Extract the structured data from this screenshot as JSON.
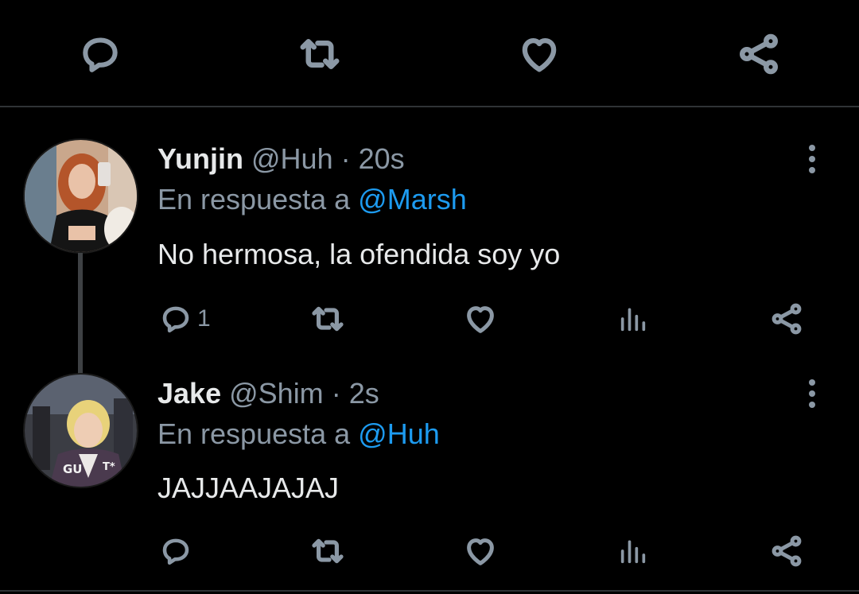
{
  "top_actions": {
    "icons": [
      "reply-icon",
      "retweet-icon",
      "like-icon",
      "share-icon"
    ]
  },
  "tweets": [
    {
      "name": "Yunjin",
      "handle": "@Huh",
      "separator": "·",
      "time": "20s",
      "reply_prefix": "En respuesta a",
      "reply_to": "@Marsh",
      "text": "No hermosa, la ofendida soy yo",
      "reply_count": "1",
      "avatar_colors": {
        "bg": "#c9a78c",
        "hair": "#b4552a",
        "top": "#151515"
      }
    },
    {
      "name": "Jake",
      "handle": "@Shim",
      "separator": "·",
      "time": "2s",
      "reply_prefix": "En respuesta a",
      "reply_to": "@Huh",
      "text": "JAJJAAJAJAJ",
      "reply_count": "",
      "avatar_colors": {
        "bg": "#3b3d44",
        "hair": "#e8d27a",
        "jacket": "#4a3a4e"
      }
    }
  ],
  "colors": {
    "background": "#000000",
    "primary_text": "#e7e9ea",
    "secondary_text": "#8b98a5",
    "accent": "#1d9bf0",
    "divider": "#2f3336"
  }
}
